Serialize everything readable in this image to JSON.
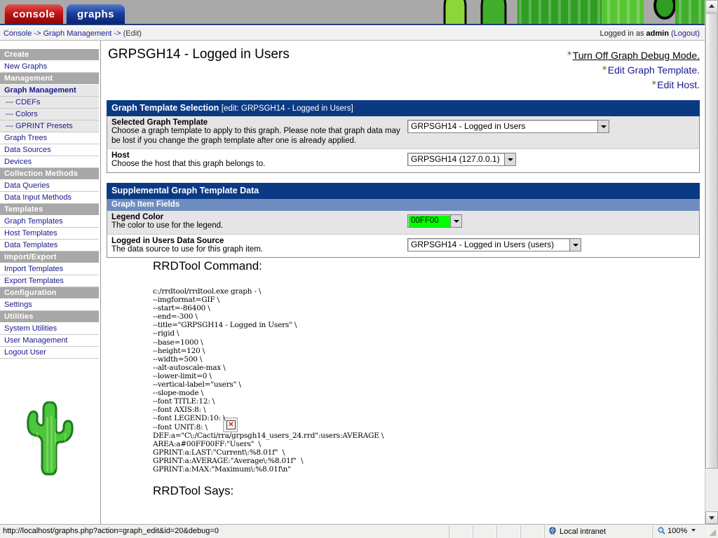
{
  "browser": {
    "status_url": "http://localhost/graphs.php?action=graph_edit&id=20&debug=0",
    "zone_label": "Local intranet",
    "zoom_level": "100%"
  },
  "banner": {
    "tabs": [
      {
        "id": "console",
        "label": "console"
      },
      {
        "id": "graphs",
        "label": "graphs"
      }
    ]
  },
  "breadcrumb": {
    "console": "Console",
    "sep1": "->",
    "section": "Graph Management",
    "sep2": "->",
    "current": "(Edit)",
    "logged_in_prefix": "Logged in as",
    "user": "admin",
    "logout": "(Logout)"
  },
  "sidebar": {
    "groups": [
      {
        "header": "Create",
        "items": [
          {
            "label": "New Graphs",
            "style": "plain"
          }
        ]
      },
      {
        "header": "Management",
        "items": [
          {
            "label": "Graph Management",
            "style": "current"
          },
          {
            "label": "--- CDEFs",
            "style": "sub"
          },
          {
            "label": "--- Colors",
            "style": "sub"
          },
          {
            "label": "--- GPRINT Presets",
            "style": "sub"
          },
          {
            "label": "Graph Trees",
            "style": "plain"
          },
          {
            "label": "Data Sources",
            "style": "plain"
          },
          {
            "label": "Devices",
            "style": "plain"
          }
        ]
      },
      {
        "header": "Collection Methods",
        "items": [
          {
            "label": "Data Queries",
            "style": "plain"
          },
          {
            "label": "Data Input Methods",
            "style": "plain"
          }
        ]
      },
      {
        "header": "Templates",
        "items": [
          {
            "label": "Graph Templates",
            "style": "plain"
          },
          {
            "label": "Host Templates",
            "style": "plain"
          },
          {
            "label": "Data Templates",
            "style": "plain"
          }
        ]
      },
      {
        "header": "Import/Export",
        "items": [
          {
            "label": "Import Templates",
            "style": "plain"
          },
          {
            "label": "Export Templates",
            "style": "plain"
          }
        ]
      },
      {
        "header": "Configuration",
        "items": [
          {
            "label": "Settings",
            "style": "plain"
          }
        ]
      },
      {
        "header": "Utilities",
        "items": [
          {
            "label": "System Utilities",
            "style": "plain"
          },
          {
            "label": "User Management",
            "style": "plain"
          },
          {
            "label": "Logout User",
            "style": "plain"
          }
        ]
      }
    ]
  },
  "page": {
    "title": "GRPSGH14 - Logged in Users",
    "actions": [
      {
        "label": "Turn Off Graph Debug Mode.",
        "state": "visited"
      },
      {
        "label": "Edit Graph Template.",
        "state": "normal"
      },
      {
        "label": "Edit Host.",
        "state": "normal"
      }
    ]
  },
  "template_selection": {
    "header_title": "Graph Template Selection",
    "header_sub": "[edit: GRPSGH14 - Logged in Users]",
    "rows": [
      {
        "name": "Selected Graph Template",
        "text": "Choose a graph template to apply to this graph. Please note that graph data may be lost if you change the graph template after one is already applied.",
        "value": "GRPSGH14 - Logged in Users"
      },
      {
        "name": "Host",
        "text": "Choose the host that this graph belongs to.",
        "value": "GRPSGH14 (127.0.0.1)"
      }
    ]
  },
  "supplemental": {
    "header_title": "Supplemental Graph Template Data",
    "subheader": "Graph Item Fields",
    "rows": [
      {
        "name": "Legend Color",
        "text": "The color to use for the legend.",
        "value": "00FF00",
        "swatch": "#00FF00"
      },
      {
        "name": "Logged in Users Data Source",
        "text": "The data source to use for this graph item.",
        "value": "GRPSGH14 - Logged in Users (users)"
      }
    ]
  },
  "rrdtool": {
    "command_heading": "RRDTool Command:",
    "says_heading": "RRDTool Says:",
    "command": "c:/rrdtool/rrdtool.exe graph - \\\n--imgformat=GIF \\\n--start=-86400 \\\n--end=-300 \\\n--title=\"GRPSGH14 - Logged in Users\" \\\n--rigid \\\n--base=1000 \\\n--height=120 \\\n--width=500 \\\n--alt-autoscale-max \\\n--lower-limit=0 \\\n--vertical-label=\"users\" \\\n--slope-mode \\\n--font TITLE:12: \\\n--font AXIS:8: \\\n--font LEGEND:10: \\\n--font UNIT:8: \\\nDEF:a=\"C\\:/Cacti/rra/grpsgh14_users_24.rrd\":users:AVERAGE \\\nAREA:a#00FF00FF:\"Users\"  \\\nGPRINT:a:LAST:\"Current\\:%8.01f\"  \\\nGPRINT:a:AVERAGE:\"Average\\:%8.01f\"  \\\nGPRINT:a:MAX:\"Maximum\\:%8.01f\\n\""
  },
  "colors": {
    "panel_header": "#0B3A85",
    "sub_header": "#6E8CC0",
    "nav_header": "#A8A8A8",
    "link": "#1B1B8F",
    "legend_green": "#00FF00"
  }
}
